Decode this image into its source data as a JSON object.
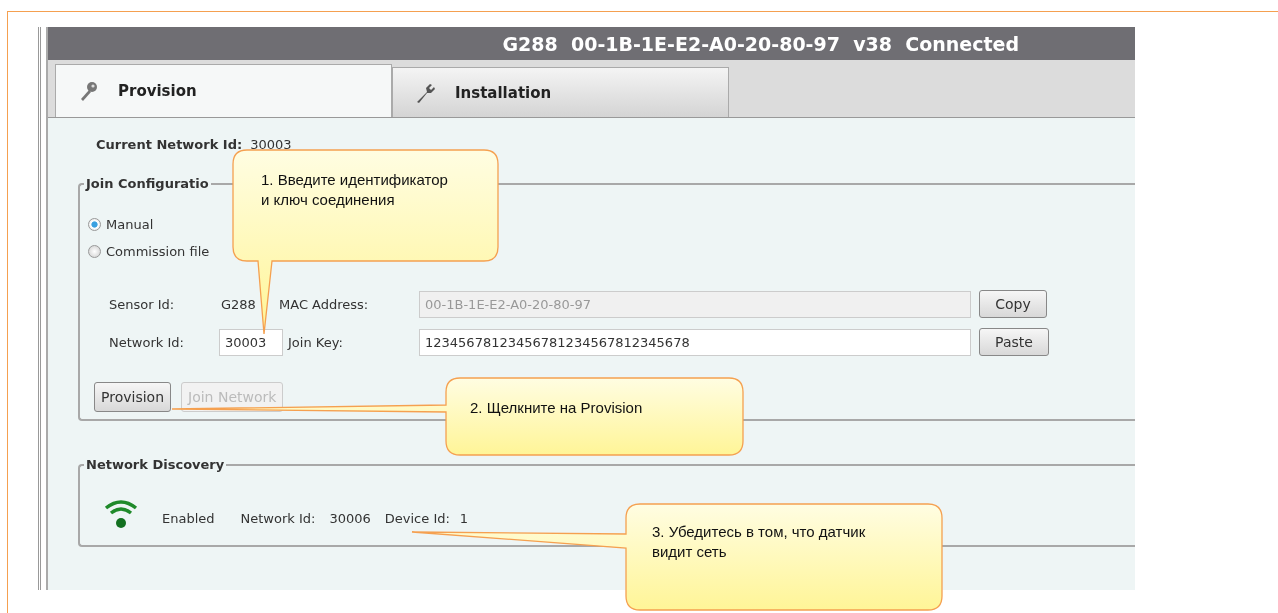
{
  "window": {
    "title": "G288  00-1B-1E-E2-A0-20-80-97  v38  Connected"
  },
  "tabs": [
    {
      "label": "Provision",
      "selected": true
    },
    {
      "label": "Installation",
      "selected": false
    }
  ],
  "current_network": {
    "label": "Current Network Id:",
    "value": "30003"
  },
  "join_configuration": {
    "title": "Join Configuratio",
    "options": [
      {
        "label": "Manual",
        "selected": true
      },
      {
        "label": "Commission file",
        "selected": false
      }
    ],
    "sensor_id": {
      "label": "Sensor Id:",
      "value": "G288"
    },
    "mac_address": {
      "label": "MAC Address:",
      "value": "00-1B-1E-E2-A0-20-80-97",
      "disabled": true
    },
    "copy_button": "Copy",
    "network_id": {
      "label": "Network Id:",
      "value": "30003"
    },
    "join_key": {
      "label": "Join Key:",
      "value": "12345678123456781234567812345678",
      "disabled": false
    },
    "paste_button": "Paste",
    "buttons": [
      {
        "label": "Provision",
        "disabled": false
      },
      {
        "label": "Join Network",
        "disabled": true
      }
    ]
  },
  "network_discovery": {
    "title": "Network Discovery",
    "status": "Enabled",
    "network_id_label": "Network Id:",
    "network_id": "30006",
    "device_id_label": "Device Id:",
    "device_id": "1"
  },
  "callouts": [
    {
      "text": "1. Введите идентификатор и ключ соединения"
    },
    {
      "text": "2. Щелкните на Provision"
    },
    {
      "text": "3. Убедитесь в том, что датчик видит сеть"
    }
  ]
}
